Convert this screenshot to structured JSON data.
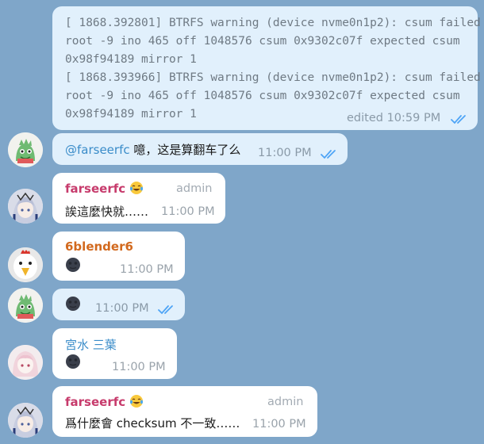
{
  "colors": {
    "background": "#7fa6c9",
    "outgoing_bubble": "#e1f0fc",
    "incoming_bubble": "#ffffff",
    "mention": "#3a8cc9",
    "farseerfc_name": "#c73b6c",
    "blender_name": "#d2691e",
    "miyamizu_name": "#3a8cc9",
    "tick_blue": "#4ea4f6"
  },
  "messages": [
    {
      "lines": [
        "[ 1868.392801] BTRFS warning (device nvme0n1p2): csum failed",
        "root -9 ino 465 off 1048576 csum 0x9302c07f expected csum",
        "0x98f94189 mirror 1",
        "[ 1868.393966] BTRFS warning (device nvme0n1p2): csum failed",
        "root -9 ino 465 off 1048576 csum 0x9302c07f expected csum",
        "0x98f94189 mirror 1"
      ],
      "meta": "edited 10:59 PM",
      "status": "double-check-read"
    },
    {
      "mention": "@farseerfc",
      "text": " 噫，这是算翻车了么",
      "meta": "11:00 PM",
      "status": "double-check-read",
      "avatar": "dino-avatar"
    },
    {
      "sender": "farseerfc",
      "sender_emoji": "tears-of-joy-emoji",
      "role": "admin",
      "text": "誒這麼快就……",
      "meta": "11:00 PM",
      "avatar": "anime-girl-avatar"
    },
    {
      "sender": "6blender6",
      "text_emoji": "new-moon-face-emoji",
      "meta": "11:00 PM",
      "avatar": "chicken-avatar"
    },
    {
      "text_emoji": "new-moon-face-emoji",
      "meta": "11:00 PM",
      "status": "double-check-read",
      "avatar": "dino-avatar"
    },
    {
      "sender": "宮水 三葉",
      "text_emoji": "new-moon-face-emoji",
      "meta": "11:00 PM",
      "avatar": "pink-hair-avatar"
    },
    {
      "sender": "farseerfc",
      "sender_emoji": "tears-of-joy-emoji",
      "role": "admin",
      "text": "爲什麼會 checksum 不一致……",
      "meta": "11:00 PM",
      "avatar": "anime-girl-avatar"
    }
  ]
}
